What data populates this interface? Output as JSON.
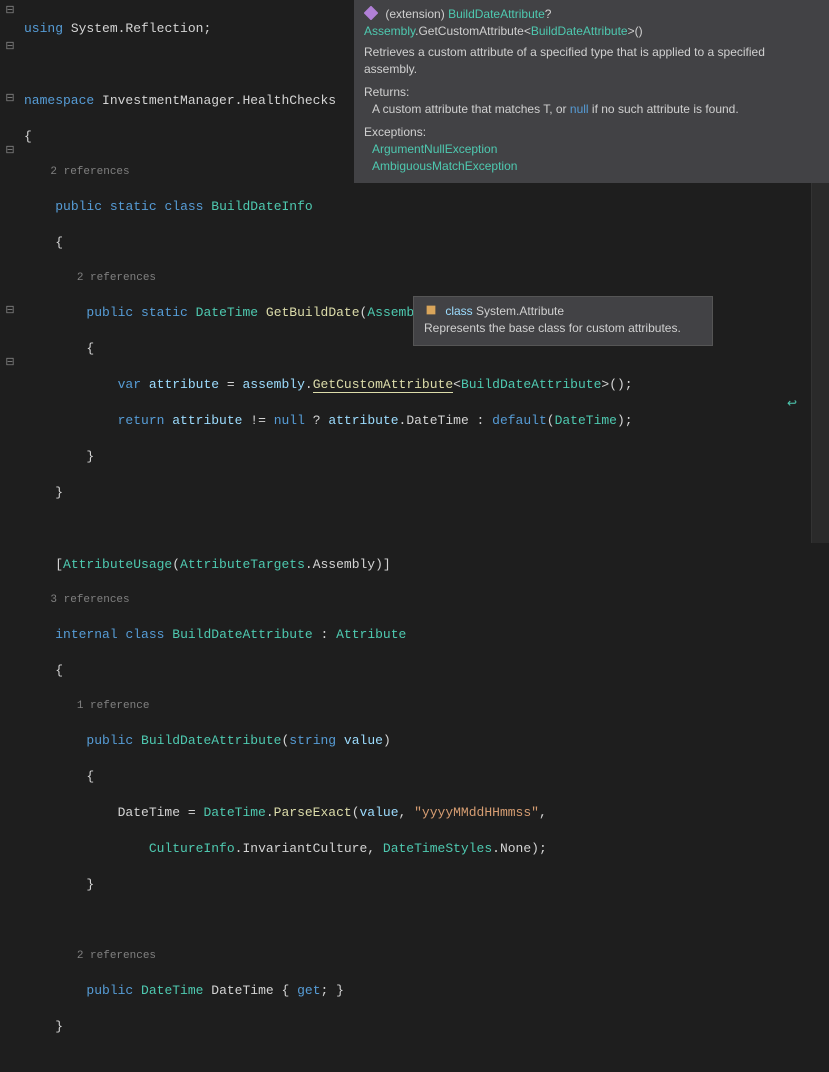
{
  "code": {
    "using": "using",
    "ns_kw": "namespace",
    "ns": "InvestmentManager.HealthChecks",
    "sys_reflection": "System.Reflection",
    "public": "public",
    "static": "static",
    "class": "class",
    "internal": "internal",
    "class1": "BuildDateInfo",
    "class2": "BuildDateAttribute",
    "dt": "DateTime",
    "method1": "GetBuildDate",
    "asm_type": "Assembly",
    "asm_param": "assembly",
    "var": "var",
    "attr_var": "attribute",
    "gca": "GetCustomAttribute",
    "return": "return",
    "null": "null",
    "default": "default",
    "au": "AttributeUsage",
    "at": "AttributeTargets",
    "assembly_enum": "Assembly",
    "attribute_base": "Attribute",
    "string": "string",
    "value": "value",
    "parseExact": "ParseExact",
    "fmt": "\"yyyyMMddHHmmss\"",
    "cultureInfo": "CultureInfo",
    "invariant": "InvariantCulture",
    "dts": "DateTimeStyles",
    "none": "None",
    "get": "get",
    "ref2": "2 references",
    "ref3": "3 references",
    "ref1": "1 reference"
  },
  "tooltip1": {
    "prefix": "(extension)",
    "ret_type": "BuildDateAttribute",
    "asm": "Assembly",
    "method": "GetCustomAttribute",
    "generic": "BuildDateAttribute",
    "desc": "Retrieves a custom attribute of a specified type that is applied to a specified assembly.",
    "returns_h": "Returns:",
    "returns_1": "A custom attribute that matches T, or",
    "null": "null",
    "returns_2": "if no such attribute is found.",
    "exceptions_h": "Exceptions:",
    "exc1": "ArgumentNullException",
    "exc2": "AmbiguousMatchException"
  },
  "tooltip2": {
    "kw": "class",
    "name": "System.Attribute",
    "desc": "Represents the base class for custom attributes."
  }
}
